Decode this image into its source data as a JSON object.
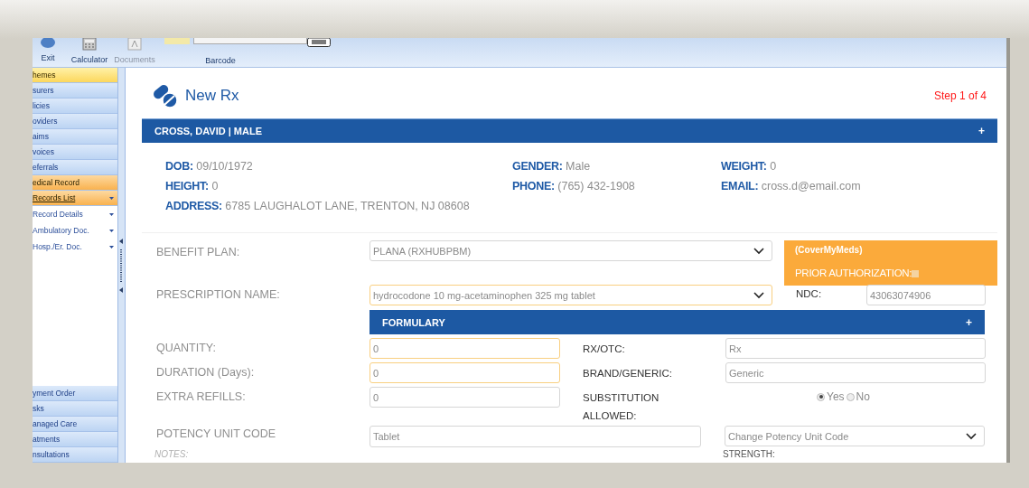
{
  "toolbar": {
    "buttons": [
      {
        "kind": "exit",
        "label": "Exit",
        "disabled": false
      },
      {
        "kind": "calculator",
        "label": "Calculator",
        "disabled": false
      },
      {
        "kind": "documents",
        "label": "Documents",
        "disabled": true
      }
    ],
    "barcode": {
      "label": "Barcode"
    }
  },
  "sidebar": {
    "items": [
      {
        "kind": "bar",
        "label": "hemes",
        "hovered": true,
        "selected": false
      },
      {
        "kind": "bar",
        "label": "surers",
        "hovered": false,
        "selected": false
      },
      {
        "kind": "bar",
        "label": "licies",
        "hovered": false,
        "selected": false
      },
      {
        "kind": "bar",
        "label": "oviders",
        "hovered": false,
        "selected": false
      },
      {
        "kind": "bar",
        "label": "aims",
        "hovered": false,
        "selected": false
      },
      {
        "kind": "bar",
        "label": "voices",
        "hovered": false,
        "selected": false
      },
      {
        "kind": "bar",
        "label": "eferrals",
        "hovered": false,
        "selected": false
      },
      {
        "kind": "bar",
        "label": "edical Record",
        "hovered": false,
        "selected": true
      },
      {
        "kind": "link",
        "label": "Records List",
        "hovered": false,
        "selected": true
      },
      {
        "kind": "link",
        "label": "Record Details",
        "hovered": false,
        "selected": false
      },
      {
        "kind": "link",
        "label": "Ambulatory Doc.",
        "hovered": false,
        "selected": false
      },
      {
        "kind": "link",
        "label": "Hosp./Er. Doc.",
        "hovered": false,
        "selected": false
      }
    ],
    "bottom_items": [
      {
        "label": "yment Order"
      },
      {
        "label": "sks"
      },
      {
        "label": "anaged Care"
      },
      {
        "label": "atments"
      },
      {
        "label": "nsultations"
      }
    ]
  },
  "page": {
    "title": "New Rx",
    "step": "Step 1 of 4"
  },
  "patient": {
    "header": "CROSS, DAVID | MALE",
    "toggle": "+",
    "rows": [
      [
        {
          "label": "DOB:",
          "value": "09/10/1972"
        },
        {
          "label": "GENDER:",
          "value": "Male"
        },
        {
          "label": "WEIGHT:",
          "value": "0"
        }
      ],
      [
        {
          "label": "HEIGHT:",
          "value": "0"
        },
        {
          "label": "PHONE:",
          "value": "(765) 432-1908"
        },
        {
          "label": "EMAIL:",
          "value": "cross.d@email.com"
        }
      ],
      [
        {
          "label": "ADDRESS:",
          "value": "6785 LAUGHALOT LANE, TRENTON, NJ 08608"
        }
      ]
    ]
  },
  "form": {
    "benefit_plan": {
      "label": "BENEFIT PLAN:",
      "value": "PLANA (RXHUBPBM)",
      "highlighted": false
    },
    "prior_auth": {
      "source": "(CoverMyMeds)",
      "label": "PRIOR AUTHORIZATION:",
      "checked": false
    },
    "prescription": {
      "label": "PRESCRIPTION NAME:",
      "value": "hydrocodone 10 mg-acetaminophen 325 mg tablet",
      "highlighted": true
    },
    "ndc": {
      "label": "NDC:",
      "value": "43063074906"
    },
    "formulary": {
      "header": "FORMULARY",
      "toggle": "+"
    },
    "rows": [
      {
        "label": "QUANTITY:",
        "value": "0",
        "highlighted": true,
        "right_label": "RX/OTC:",
        "right_value": "Rx"
      },
      {
        "label": "DURATION (Days):",
        "value": "0",
        "highlighted": true,
        "right_label": "BRAND/GENERIC:",
        "right_value": "Generic"
      },
      {
        "label": "EXTRA REFILLS:",
        "value": "0",
        "highlighted": false,
        "right_label": "SUBSTITUTION ALLOWED:"
      }
    ],
    "substitution": [
      {
        "label": "Yes",
        "selected": true
      },
      {
        "label": "No",
        "selected": false
      }
    ],
    "potency": {
      "label": "POTENCY UNIT CODE",
      "value": "Tablet",
      "select_value": "Change Potency Unit Code"
    },
    "notes": {
      "label": "NOTES:"
    },
    "strength": {
      "label": "STRENGTH:"
    }
  }
}
